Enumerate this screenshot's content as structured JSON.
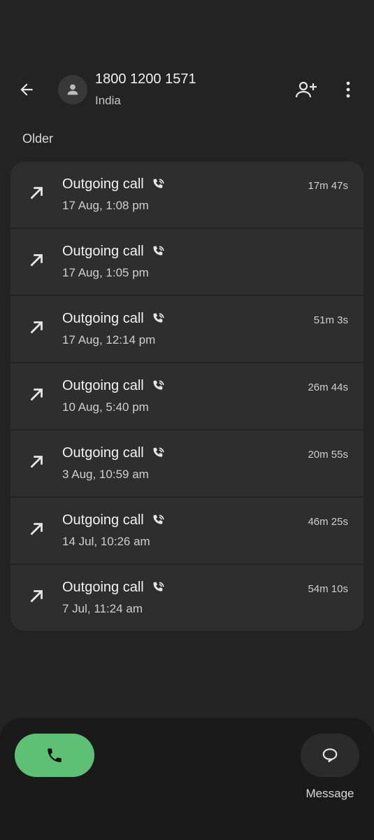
{
  "contact": {
    "name": "1800 1200 1571",
    "location": "India"
  },
  "section": {
    "label": "Older"
  },
  "calls": [
    {
      "type": "Outgoing call",
      "time": "17 Aug, 1:08 pm",
      "duration": "17m 47s"
    },
    {
      "type": "Outgoing call",
      "time": "17 Aug, 1:05 pm",
      "duration": ""
    },
    {
      "type": "Outgoing call",
      "time": "17 Aug, 12:14 pm",
      "duration": "51m 3s"
    },
    {
      "type": "Outgoing call",
      "time": "10 Aug, 5:40 pm",
      "duration": "26m 44s"
    },
    {
      "type": "Outgoing call",
      "time": "3 Aug, 10:59 am",
      "duration": "20m 55s"
    },
    {
      "type": "Outgoing call",
      "time": "14 Jul, 10:26 am",
      "duration": "46m 25s"
    },
    {
      "type": "Outgoing call",
      "time": "7 Jul, 11:24 am",
      "duration": "54m 10s"
    }
  ],
  "actions": {
    "message_label": "Message"
  },
  "colors": {
    "background": "#232323",
    "row": "#2e2e2e",
    "call_button": "#5ec075",
    "panel": "#1a1a1a"
  },
  "icons": {
    "back": "arrow-left-icon",
    "avatar": "person-icon",
    "add_contact": "person-add-icon",
    "more": "more-vert-icon",
    "direction": "outgoing-arrow-icon",
    "wifi_call": "wifi-call-icon",
    "call": "phone-icon",
    "message": "message-bubble-icon"
  }
}
